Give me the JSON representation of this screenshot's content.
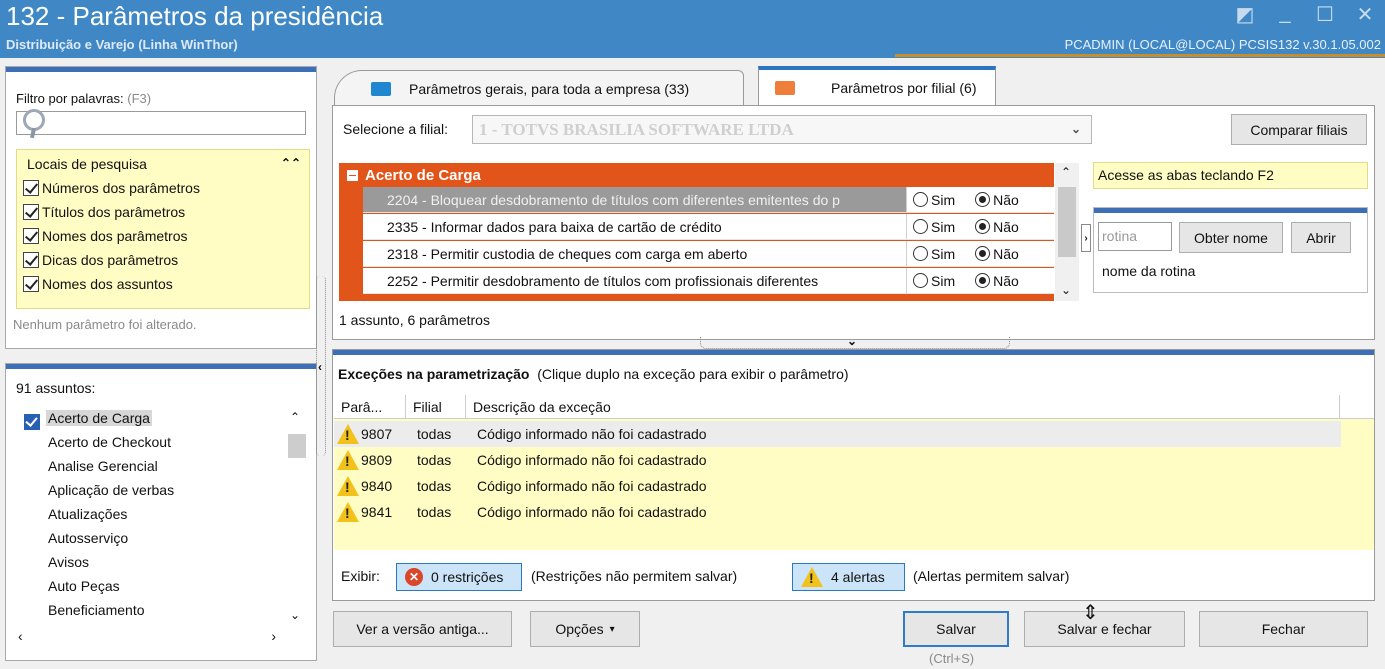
{
  "window": {
    "title": "132 - Parâmetros da presidência",
    "subtitle": "Distribuição e Varejo (Linha WinThor)",
    "user_info": "PCADMIN (LOCAL@LOCAL)  PCSIS132  v.30.1.05.002"
  },
  "filter": {
    "label": "Filtro por palavras:",
    "hint": "(F3)",
    "search_value": "",
    "locais_title": "Locais de pesquisa",
    "locais": [
      "Números dos parâmetros",
      "Títulos dos parâmetros",
      "Nomes dos parâmetros",
      "Dicas dos parâmetros",
      "Nomes dos assuntos"
    ],
    "status": "Nenhum parâmetro foi alterado."
  },
  "assuntos": {
    "label": "91 assuntos:",
    "items": [
      "Acerto de Carga",
      "Acerto de Checkout",
      "Analise Gerencial",
      "Aplicação de verbas",
      "Atualizações",
      "Autosserviço",
      "Avisos",
      "Auto Peças",
      "Beneficiamento"
    ]
  },
  "tabs": [
    {
      "label": "Parâmetros gerais, para toda a empresa",
      "count": "(33)"
    },
    {
      "label": "Parâmetros por filial",
      "count": "(6)"
    }
  ],
  "filial": {
    "label": "Selecione a filial:",
    "value": "1 - TOTVS BRASILIA SOFTWARE LTDA",
    "compare_button": "Comparar filiais"
  },
  "grid": {
    "group": "Acerto de Carga",
    "sim_label": "Sim",
    "nao_label": "Não",
    "rows": [
      {
        "desc": "2204 - Bloquear desdobramento de títulos com diferentes emitentes do p",
        "value": "Não"
      },
      {
        "desc": "2335 - Informar dados para baixa de cartão de crédito",
        "value": "Não"
      },
      {
        "desc": "2318 - Permitir custodia de cheques com carga em aberto",
        "value": "Não"
      },
      {
        "desc": "2252 - Permitir desdobramento de títulos com profissionais diferentes",
        "value": "Não"
      }
    ],
    "count": "1 assunto, 6 parâmetros"
  },
  "side": {
    "info": "Acesse as abas teclando F2",
    "rotina_placeholder": "rotina",
    "obter_button": "Obter nome",
    "abrir_button": "Abrir",
    "rotina_nome": "nome da rotina"
  },
  "excecoes": {
    "title": "Exceções na parametrização",
    "subtitle": "(Clique duplo na exceção para exibir o parâmetro)",
    "columns": [
      "Parâ...",
      "Filial",
      "Descrição da exceção"
    ],
    "rows": [
      {
        "param": "9807",
        "filial": "todas",
        "desc": "Código informado não foi cadastrado"
      },
      {
        "param": "9809",
        "filial": "todas",
        "desc": "Código informado não foi cadastrado"
      },
      {
        "param": "9840",
        "filial": "todas",
        "desc": "Código informado não foi cadastrado"
      },
      {
        "param": "9841",
        "filial": "todas",
        "desc": "Código informado não foi cadastrado"
      }
    ],
    "exibir_label": "Exibir:",
    "restricoes_button": "0 restrições",
    "restricoes_note": "(Restrições não permitem salvar)",
    "alertas_button": "4 alertas",
    "alertas_note": "(Alertas permitem salvar)"
  },
  "footer": {
    "versao_button": "Ver a versão antiga...",
    "opcoes_button": "Opções",
    "salvar_button": "Salvar",
    "salvar_fechar_button": "Salvar e fechar",
    "fechar_button": "Fechar",
    "shortcut": "(Ctrl+S)"
  }
}
